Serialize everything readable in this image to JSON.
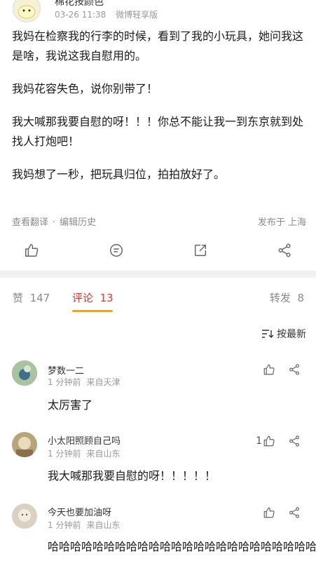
{
  "post": {
    "author": "棉花按颜色",
    "date": "03-26 11:38",
    "source": "微博轻享版",
    "paragraphs": [
      "我妈在检察我的行李的时候，看到了我的小玩具，她问我这是啥，我说这我自慰用的。",
      "我妈花容失色，说你别带了！",
      "我大喊那我要自慰的呀！！！你总不能让我一到东京就到处找人打炮吧！",
      "我妈想了一秒，把玩具归位，拍拍放好了。"
    ],
    "translate_label": "查看翻译",
    "edit_history_label": "编辑历史",
    "published_location": "发布于 上海"
  },
  "actions": {
    "like": "like-icon",
    "comment": "comment-icon",
    "repost": "repost-icon",
    "share": "share-icon"
  },
  "stats": {
    "likes_label": "赞",
    "likes_count": "147",
    "comments_label": "评论",
    "comments_count": "13",
    "reposts_label": "转发",
    "reposts_count": "8"
  },
  "sort_label": "按最新",
  "comments": [
    {
      "name": "梦数一二",
      "time": "1 分钟前",
      "location": "来自天津",
      "text": "太厉害了",
      "likes": ""
    },
    {
      "name": "小太阳照顾自己吗",
      "time": "1 分钟前",
      "location": "来自山东",
      "text": "我大喊那我要自慰的呀！！！！！",
      "likes": "1"
    },
    {
      "name": "今天也要加油呀",
      "time": "1 分钟前",
      "location": "来自山东",
      "text": "哈哈哈哈哈哈哈哈哈哈哈哈哈哈哈哈哈哈哈哈哈哈哈哈哈",
      "likes": ""
    }
  ],
  "colors": {
    "accent": "#e5342b",
    "underline": "#f4a21e",
    "muted": "#8a8a8a"
  }
}
